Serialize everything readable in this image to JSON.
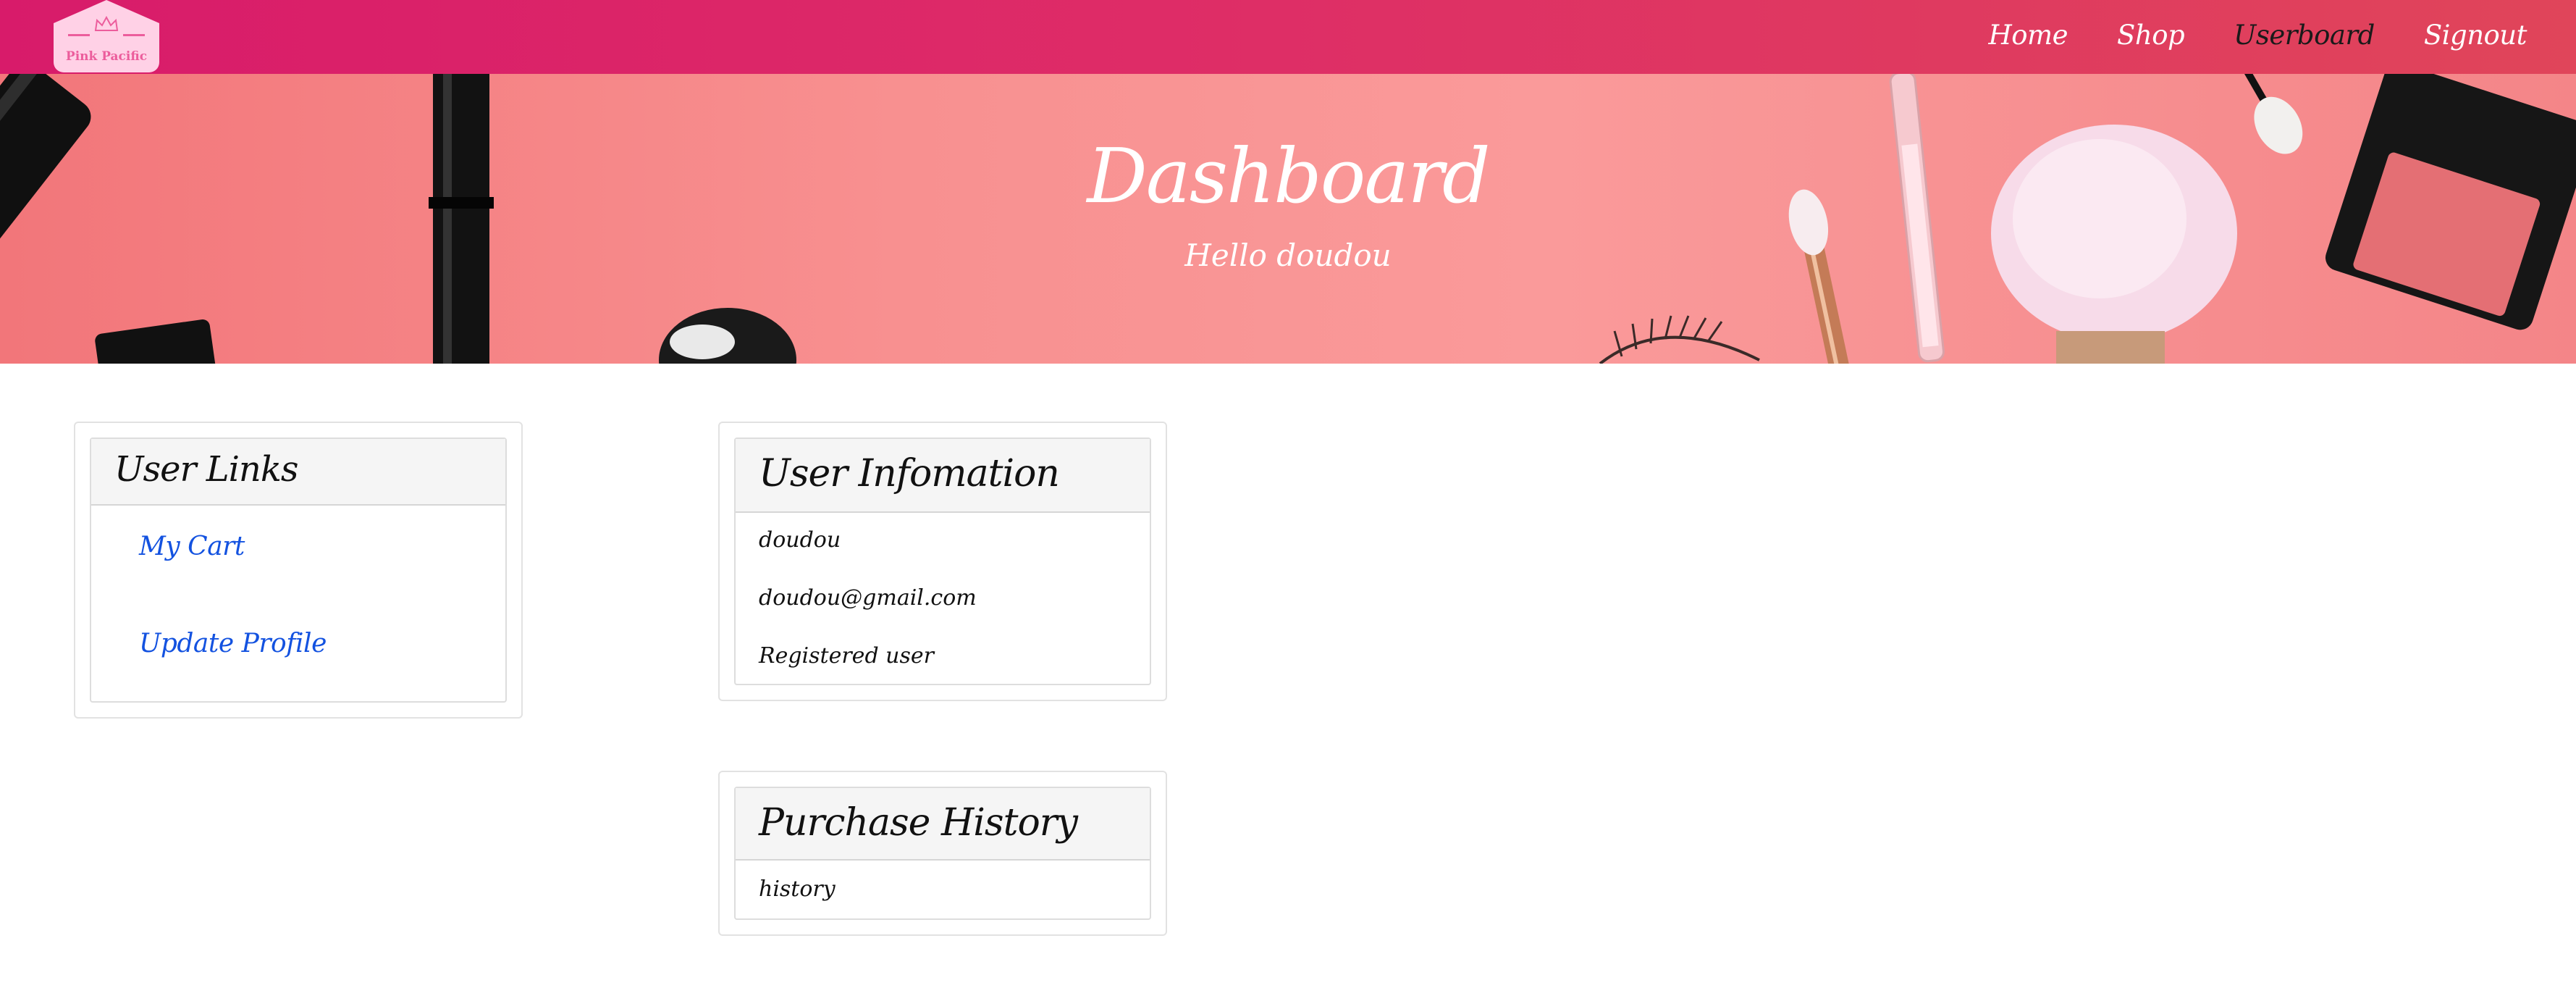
{
  "brand": {
    "name": "Pink Pacific",
    "icon": "crown-icon"
  },
  "nav": {
    "links": [
      {
        "label": "Home"
      },
      {
        "label": "Shop"
      },
      {
        "label": "Userboard"
      },
      {
        "label": "Signout"
      }
    ],
    "active": "Userboard"
  },
  "hero": {
    "title": "Dashboard",
    "subtitle": "Hello doudou"
  },
  "user_links": {
    "title": "User Links",
    "items": [
      {
        "label": "My Cart"
      },
      {
        "label": "Update Profile"
      }
    ]
  },
  "user_info": {
    "title": "User Infomation",
    "username": "doudou",
    "email": "doudou@gmail.com",
    "role": "Registered user"
  },
  "purchase_history": {
    "title": "Purchase History",
    "content": "history"
  },
  "colors": {
    "navbar_start": "#d81b6a",
    "navbar_end": "#e0455a",
    "hero_background": "#f89090",
    "link": "#1352e0",
    "brand_badge": "#ffd1e6"
  }
}
